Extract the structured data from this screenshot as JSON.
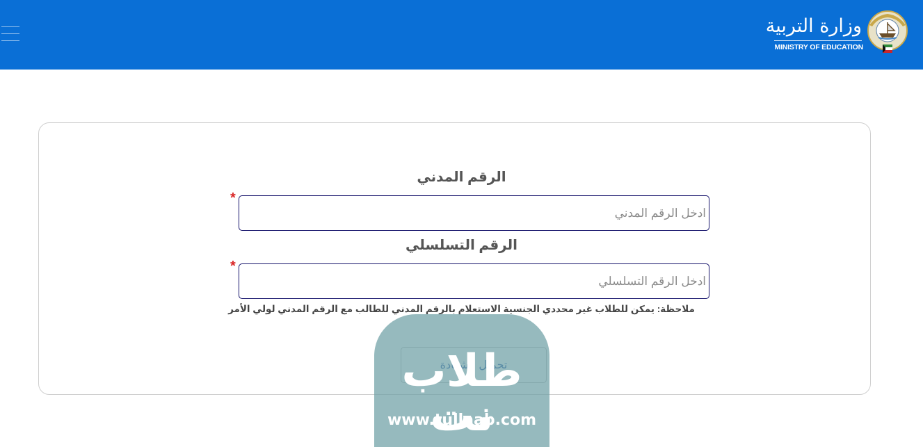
{
  "header": {
    "brand_ar": "وزارة التربية",
    "brand_en": "MINISTRY OF EDUCATION",
    "menu_icon": "hamburger-icon",
    "emblem_icon": "kuwait-emblem-icon",
    "background_color": "#0a6fd6"
  },
  "form": {
    "civil_id": {
      "label": "الرقم المدني",
      "placeholder": "ادخل الرقم المدني",
      "required_mark": "*"
    },
    "serial_number": {
      "label": "الرقم التسلسلي",
      "placeholder": "ادخل الرقم التسلسلي",
      "required_mark": "*"
    },
    "note": "ملاحظة: يمكن للطلاب غير محددي الجنسية الاستعلام بالرقم المدني للطالب مع الرقم المدني لولي الأمر",
    "submit_label": "تحميل الشهادة"
  },
  "watermark": {
    "text_ar": "طلاب نت",
    "url": "www.tullaab.com"
  }
}
